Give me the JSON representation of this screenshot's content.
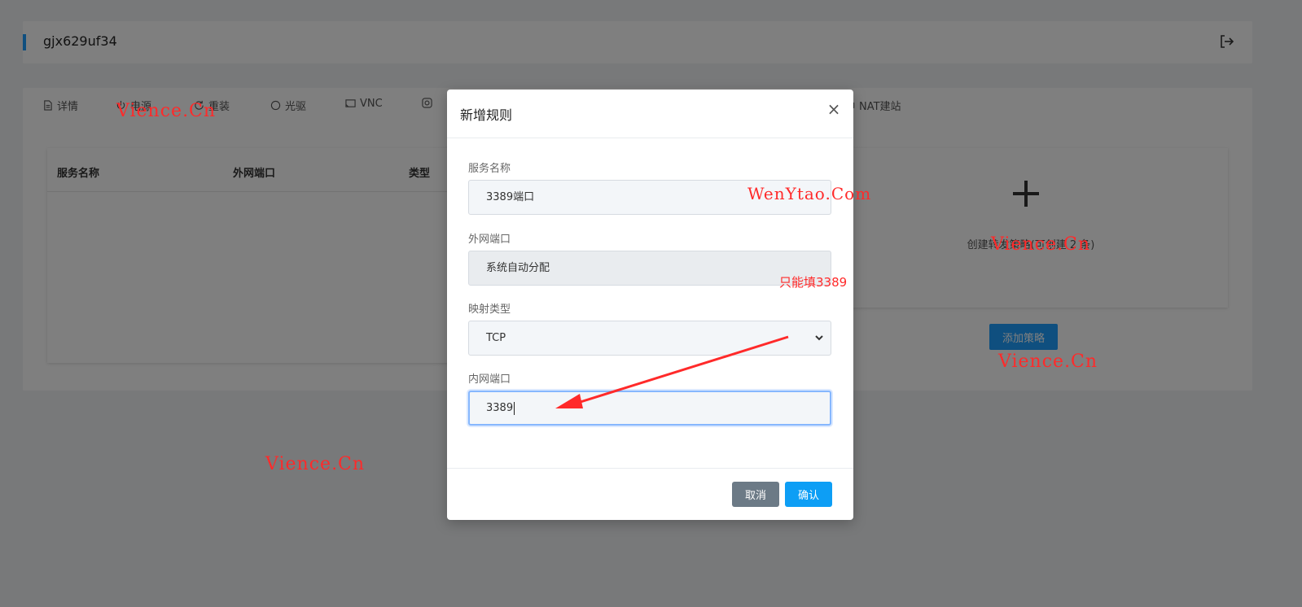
{
  "header": {
    "title": "gjx629uf34",
    "logout_icon": "logout-icon"
  },
  "tabs": [
    {
      "label": "详情",
      "icon": "document-icon"
    },
    {
      "label": "电源",
      "icon": "power-icon"
    },
    {
      "label": "重装",
      "icon": "refresh-icon"
    },
    {
      "label": "光驱",
      "icon": "disc-icon"
    },
    {
      "label": "VNC",
      "icon": "screen-icon"
    },
    {
      "label": "",
      "icon": "camera-icon"
    },
    {
      "label": "NAT建站",
      "icon": "cube-icon"
    }
  ],
  "table": {
    "columns": [
      "服务名称",
      "外网端口",
      "类型"
    ]
  },
  "create_panel": {
    "text": "创建转发策略(可创建 2 条)",
    "add_button": "添加策略"
  },
  "modal": {
    "title": "新增规则",
    "close": "×",
    "fields": {
      "service_name": {
        "label": "服务名称",
        "value": "3389端口"
      },
      "external_port": {
        "label": "外网端口",
        "value": "系统自动分配"
      },
      "mapping_type": {
        "label": "映射类型",
        "value": "TCP"
      },
      "internal_port": {
        "label": "内网端口",
        "value": "3389"
      }
    },
    "cancel": "取消",
    "confirm": "确认"
  },
  "annotations": {
    "watermark_1": "Vience.Cn",
    "watermark_2": "WenYtao.Com",
    "watermark_3": "Vience.Cn",
    "watermark_4": "Vience.Cn",
    "watermark_5": "Vience.Cn",
    "note": "只能填3389"
  },
  "colors": {
    "accent": "#1e9fff",
    "confirm": "#0d9ef5",
    "cancel": "#6c7a86",
    "annotation": "#ff2a2a"
  }
}
